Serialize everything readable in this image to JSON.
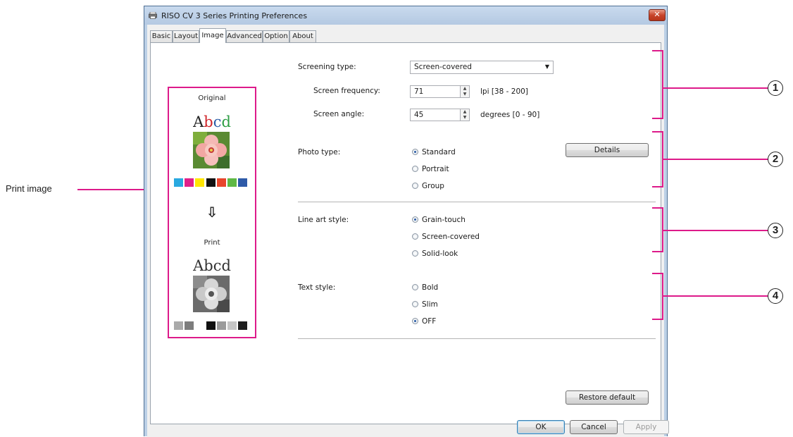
{
  "window": {
    "title": "RISO CV 3 Series Printing Preferences",
    "close": "✕"
  },
  "tabs": [
    "Basic",
    "Layout",
    "Image",
    "Advanced",
    "Option",
    "About"
  ],
  "preview": {
    "original_label": "Original",
    "print_label": "Print",
    "sample_text": [
      "A",
      "b",
      "c",
      "d"
    ],
    "arrow": "⇩",
    "original_colors": [
      "#29a9e0",
      "#e0218a",
      "#ffe600",
      "#111111",
      "#e8452c",
      "#5fb845",
      "#2e5aa8"
    ],
    "print_colors": [
      "#aaaaaa",
      "#7d7d7d",
      "#ffffff",
      "#111111",
      "#9a9a9a",
      "#c6c6c6",
      "#1e1e1e"
    ]
  },
  "screening": {
    "label": "Screening type:",
    "value": "Screen-covered",
    "frequency_label": "Screen frequency:",
    "frequency_value": "71",
    "frequency_unit": "lpi [38 - 200]",
    "angle_label": "Screen angle:",
    "angle_value": "45",
    "angle_unit": "degrees [0 - 90]"
  },
  "photo": {
    "label": "Photo type:",
    "options": [
      "Standard",
      "Portrait",
      "Group"
    ],
    "selected": "Standard",
    "details_button": "Details"
  },
  "lineart": {
    "label": "Line art style:",
    "options": [
      "Grain-touch",
      "Screen-covered",
      "Solid-look"
    ],
    "selected": "Grain-touch"
  },
  "text_style": {
    "label": "Text style:",
    "options": [
      "Bold",
      "Slim",
      "OFF"
    ],
    "selected": "OFF"
  },
  "buttons": {
    "restore": "Restore default",
    "ok": "OK",
    "cancel": "Cancel",
    "apply": "Apply"
  },
  "annotations": {
    "print_image": "Print image",
    "markers": [
      "1",
      "2",
      "3",
      "4"
    ],
    "accent_color": "#dd1a8a"
  }
}
